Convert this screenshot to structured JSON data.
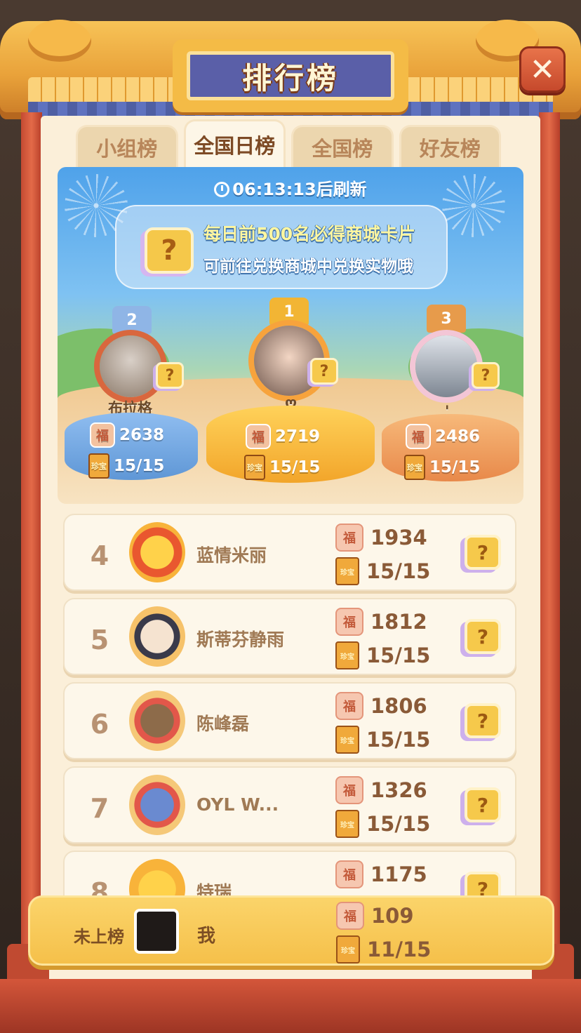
{
  "header": {
    "title": "排行榜",
    "close_label": "✕"
  },
  "tabs": [
    {
      "label": "小组榜",
      "active": false
    },
    {
      "label": "全国日榜",
      "active": true
    },
    {
      "label": "全国榜",
      "active": false
    },
    {
      "label": "好友榜",
      "active": false
    }
  ],
  "podium": {
    "refresh_text": "06:13:13后刷新",
    "promo_line1": "每日前500名必得商城卡片",
    "promo_line2": "可前往兑换商城中兑换实物哦",
    "card_glyph": "?",
    "first": {
      "rank": "1",
      "name": "ღ",
      "score": "2719",
      "progress": "15/15"
    },
    "second": {
      "rank": "2",
      "name": "布拉格",
      "score": "2638",
      "progress": "15/15"
    },
    "third": {
      "rank": "3",
      "name": "'",
      "score": "2486",
      "progress": "15/15"
    }
  },
  "icons": {
    "fu": "福",
    "book": "珍宝"
  },
  "list": [
    {
      "rank": "4",
      "name": "蓝情米丽",
      "score": "1934",
      "progress": "15/15"
    },
    {
      "rank": "5",
      "name": "斯蒂芬静雨",
      "score": "1812",
      "progress": "15/15"
    },
    {
      "rank": "6",
      "name": "陈峰磊",
      "score": "1806",
      "progress": "15/15"
    },
    {
      "rank": "7",
      "name": "OYL W...",
      "score": "1326",
      "progress": "15/15"
    },
    {
      "rank": "8",
      "name": "特瑞",
      "score": "1175",
      "progress": ""
    }
  ],
  "me": {
    "status": "未上榜",
    "name": "我",
    "score": "109",
    "progress": "11/15"
  },
  "colors": {
    "accent": "#f5c04a",
    "title_plate": "#5a5fa8",
    "pillar": "#c44a32",
    "panel": "#fbefd9"
  }
}
